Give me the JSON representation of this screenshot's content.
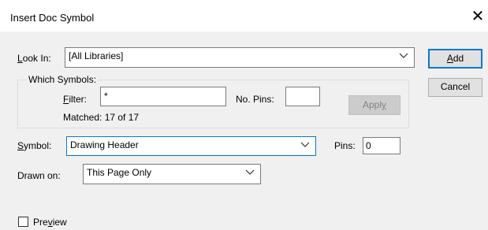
{
  "window": {
    "title": "Insert Doc Symbol",
    "close_glyph": "✕"
  },
  "look_in": {
    "label_pre": "",
    "label_key": "L",
    "label_post": "ook In:",
    "value": "[All Libraries]"
  },
  "which_symbols": {
    "legend": "Which Symbols:",
    "filter_label_key": "F",
    "filter_label_post": "ilter:",
    "filter_value": "*",
    "pins_label": "No. Pins:",
    "pins_value": "",
    "apply_label_pre": "Appl",
    "apply_label_key": "y",
    "matched_text": "Matched: 17 of 17"
  },
  "symbol": {
    "label_key": "S",
    "label_post": "ymbol:",
    "value": "Drawing Header",
    "pins_label": "Pins:",
    "pins_value": "0"
  },
  "drawn_on": {
    "label": "Drawn on:",
    "value": "This Page Only"
  },
  "buttons": {
    "add_key": "A",
    "add_post": "dd",
    "cancel": "Cancel"
  },
  "preview": {
    "label_pre": "Pre",
    "label_key": "v",
    "label_post": "iew",
    "checked": false
  },
  "colors": {
    "focus": "#0078d7",
    "dialog_bg": "#f0f0f0",
    "button_bg": "#e1e1e1"
  },
  "icons": {
    "dropdown": "chevron-down-icon",
    "close": "close-icon"
  }
}
